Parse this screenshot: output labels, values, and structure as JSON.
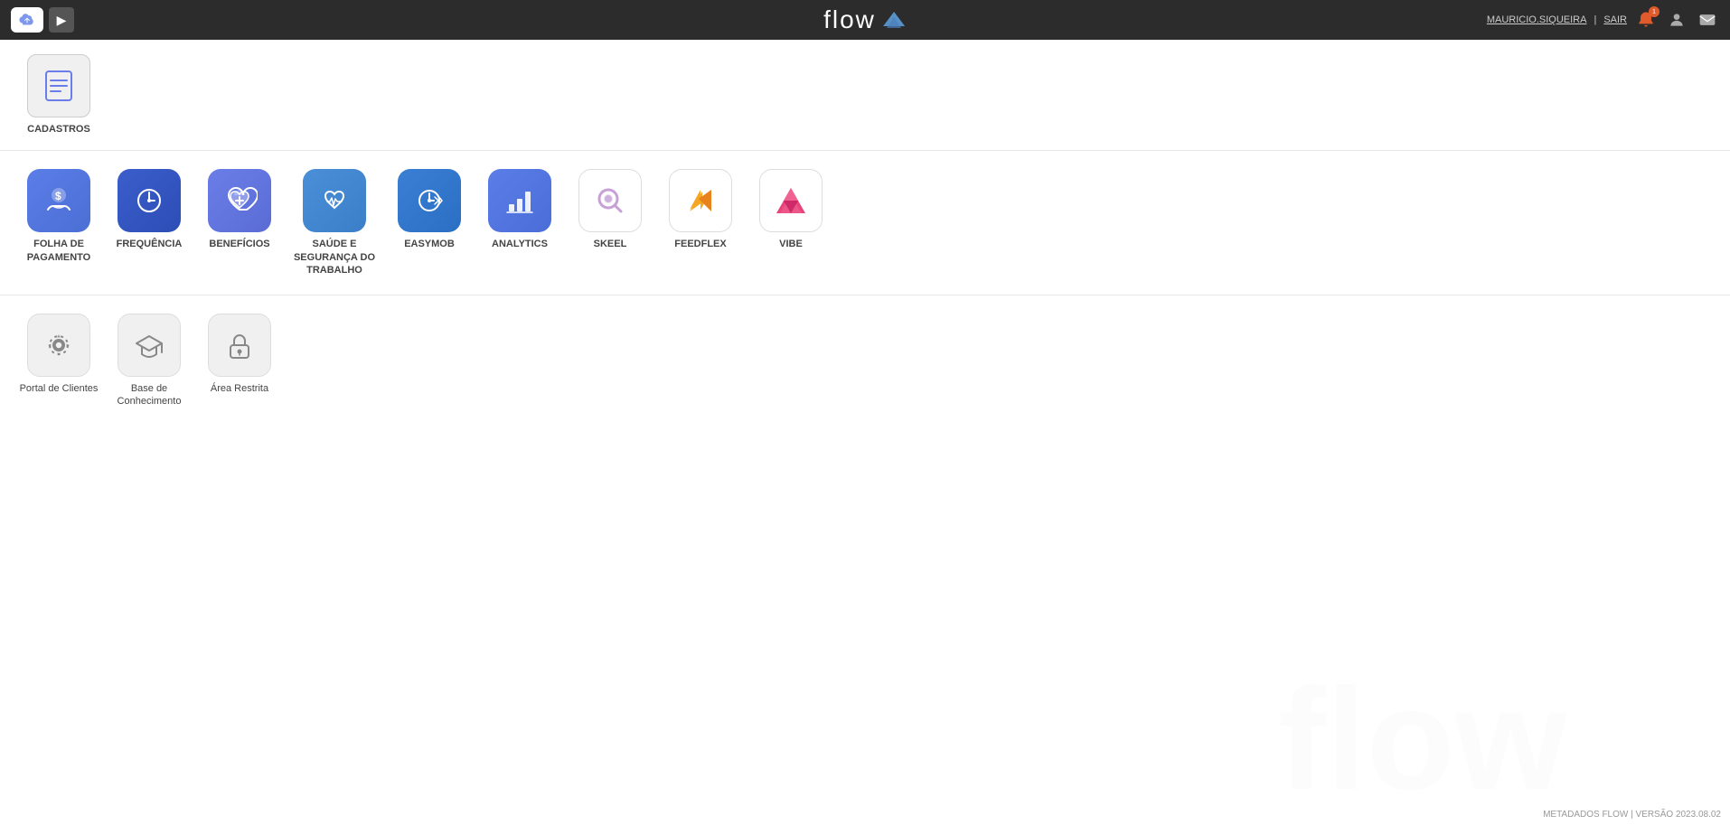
{
  "header": {
    "title": "flow",
    "user": "MAURICIO.SIQUEIRA",
    "separator": "|",
    "logout": "SAIR"
  },
  "sections": {
    "cadastros": {
      "label": "CADASTROS"
    },
    "apps": {
      "items": [
        {
          "id": "folha-pagamento",
          "label": "FOLHA DE\nPAGAMENTO",
          "color": "blue"
        },
        {
          "id": "frequencia",
          "label": "FREQUÊNCIA",
          "color": "blue"
        },
        {
          "id": "beneficios",
          "label": "BENEFÍCIOS",
          "color": "blue"
        },
        {
          "id": "saude-seguranca",
          "label": "SAÚDE E\nSEGURANÇA DO\nTRABALHO",
          "color": "blue"
        },
        {
          "id": "easymob",
          "label": "EASYMOB",
          "color": "blue"
        },
        {
          "id": "analytics",
          "label": "ANALYTICS",
          "color": "blue"
        },
        {
          "id": "skeel",
          "label": "SKEEL",
          "color": "white"
        },
        {
          "id": "feedflex",
          "label": "FEEDFLEX",
          "color": "white"
        },
        {
          "id": "vibe",
          "label": "VIBE",
          "color": "white"
        }
      ]
    },
    "support": {
      "items": [
        {
          "id": "portal-clientes",
          "label": "Portal de Clientes"
        },
        {
          "id": "base-conhecimento",
          "label": "Base de\nConhecimento"
        },
        {
          "id": "area-restrita",
          "label": "Área Restrita"
        }
      ]
    }
  },
  "footer": {
    "version_text": "METADADOS FLOW | VERSÃO 2023.08.02"
  }
}
